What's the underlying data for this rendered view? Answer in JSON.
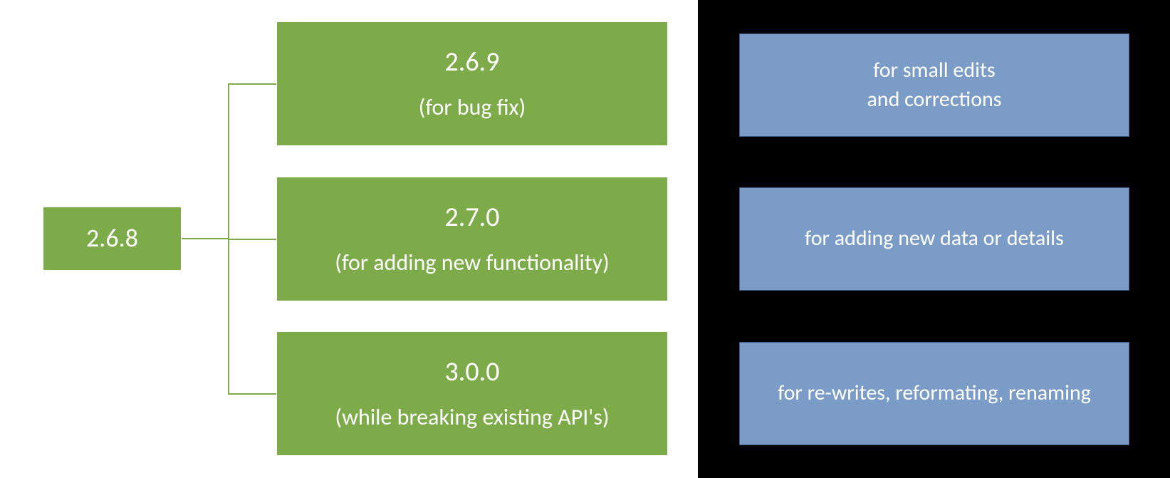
{
  "diagram": {
    "root": {
      "version": "2.6.8"
    },
    "children": [
      {
        "version": "2.6.9",
        "desc": "(for bug fix)"
      },
      {
        "version": "2.7.0",
        "desc": "(for adding new functionality)"
      },
      {
        "version": "3.0.0",
        "desc": "(while breaking existing API's)"
      }
    ],
    "notes": [
      "for small edits\nand corrections",
      "for adding new data or details",
      "for re-writes, reformating, renaming"
    ]
  },
  "colors": {
    "green": "#7eab4a",
    "blue": "#7c9cc8",
    "blue_border": "#3f5b87",
    "black": "#000000",
    "white": "#ffffff"
  }
}
